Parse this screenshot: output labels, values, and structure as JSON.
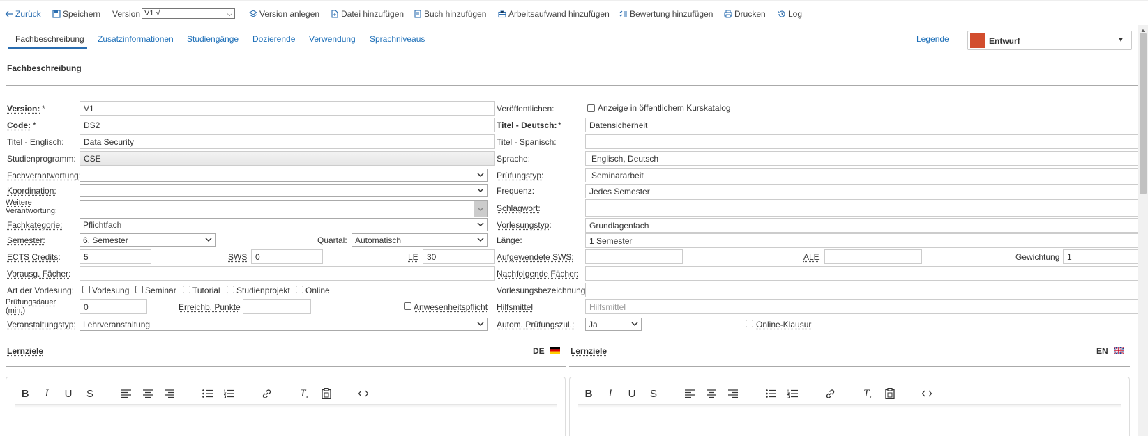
{
  "toolbar": {
    "back": "Zurück",
    "save": "Speichern",
    "version_label": "Version",
    "version_value": "V1 √",
    "create_version": "Version anlegen",
    "add_file": "Datei hinzufügen",
    "add_book": "Buch hinzufügen",
    "add_workload": "Arbeitsaufwand hinzufügen",
    "add_rating": "Bewertung hinzufügen",
    "print": "Drucken",
    "log": "Log"
  },
  "tabs": [
    "Fachbeschreibung",
    "Zusatzinformationen",
    "Studiengänge",
    "Dozierende",
    "Verwendung",
    "Sprachniveaus"
  ],
  "legend": "Legende",
  "status": {
    "label": "Entwurf",
    "color": "#d24d2d"
  },
  "section_title": "Fachbeschreibung",
  "left": {
    "version_label": "Version:",
    "version_req": "*",
    "version_value": "V1",
    "code_label": "Code:",
    "code_req": "*",
    "code_value": "DS2",
    "title_en_label": "Titel - Englisch:",
    "title_en_value": "Data Security",
    "program_label": "Studienprogramm:",
    "program_value": "CSE",
    "responsibility_label": "Fachverantwortung:",
    "responsibility_value": "",
    "coordination_label": "Koordination:",
    "coordination_value": "",
    "further_resp_label": "Weitere Verantwortung:",
    "further_resp_value": "",
    "category_label": "Fachkategorie:",
    "category_value": "Pflichtfach",
    "semester_label": "Semester:",
    "semester_value": "6. Semester",
    "quarter_label": "Quartal:",
    "quarter_value": "Automatisch",
    "ects_label": "ECTS Credits:",
    "ects_value": "5",
    "sws_label": "SWS",
    "sws_value": "0",
    "le_label": "LE",
    "le_value": "30",
    "prereq_label": "Vorausg. Fächer:",
    "prereq_value": "",
    "lecture_kind_label": "Art der Vorlesung:",
    "lecture_kinds": [
      "Vorlesung",
      "Seminar",
      "Tutorial",
      "Studienprojekt",
      "Online"
    ],
    "exam_duration_label": "Prüfungsdauer (min.)",
    "exam_duration_value": "0",
    "points_label": "Erreichb. Punkte",
    "points_value": "",
    "attendance_label": "Anwesenheitspflicht",
    "event_type_label": "Veranstaltungstyp:",
    "event_type_value": "Lehrveranstaltung"
  },
  "right": {
    "publish_label": "Veröffentlichen:",
    "publish_cb": "Anzeige in öffentlichem Kurskatalog",
    "title_de_label": "Titel - Deutsch:",
    "title_de_req": "*",
    "title_de_value": "Datensicherheit",
    "title_es_label": "Titel - Spanisch:",
    "title_es_value": "",
    "language_label": "Sprache:",
    "language_value": "Englisch, Deutsch",
    "exam_type_label": "Prüfungstyp:",
    "exam_type_value": "Seminararbeit",
    "frequency_label": "Frequenz:",
    "frequency_value": "Jedes Semester",
    "keyword_label": "Schlagwort:",
    "keyword_value": "",
    "lecture_type_label": "Vorlesungstyp:",
    "lecture_type_value": "Grundlagenfach",
    "length_label": "Länge:",
    "length_value": "1 Semester",
    "spent_sws_label": "Aufgewendete SWS:",
    "spent_sws_value": "",
    "ale_label": "ALE",
    "ale_value": "",
    "weight_label": "Gewichtung",
    "weight_value": "1",
    "following_label": "Nachfolgende Fächer:",
    "following_value": "",
    "lecture_name_label": "Vorlesungsbezeichnung:",
    "lecture_name_value": "",
    "aids_label": "Hilfsmittel",
    "aids_placeholder": "Hilfsmittel",
    "auto_exam_label": "Autom. Prüfungszul.:",
    "auto_exam_value": "Ja",
    "online_exam_label": "Online-Klausur"
  },
  "learning_goals": {
    "label_de": "Lernziele",
    "lang_de": "DE",
    "label_en": "Lernziele",
    "lang_en": "EN"
  },
  "editor_icons": [
    "bold-icon",
    "italic-icon",
    "underline-icon",
    "strikethrough-icon",
    "align-left-icon",
    "align-center-icon",
    "align-right-icon",
    "bullet-list-icon",
    "numbered-list-icon",
    "link-icon",
    "clear-format-icon",
    "paste-icon",
    "code-icon"
  ]
}
